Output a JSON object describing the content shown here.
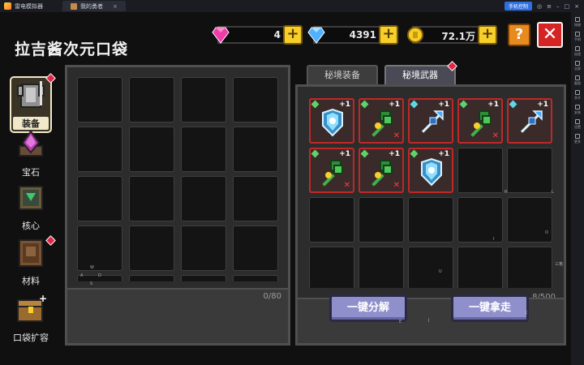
{
  "emulator": {
    "app_name": "雷电模拟器",
    "tab_title": "我的勇者",
    "control_label": "手机控制",
    "side_tools": [
      "按键",
      "手柄",
      "加速",
      "全屏",
      "截图",
      "多开",
      "安装",
      "设置",
      "更多"
    ]
  },
  "header": {
    "title": "拉吉酱次元口袋",
    "currencies": [
      {
        "name": "pink-gem",
        "value": "4",
        "color": "#f03ca8"
      },
      {
        "name": "diamond",
        "value": "4391",
        "color": "#4fb2ff"
      },
      {
        "name": "gold-coin",
        "value": "72.1万",
        "color": "#f6cf2a"
      }
    ],
    "help_label": "?",
    "close_label": "✕"
  },
  "nav": [
    {
      "label": "装备",
      "icon": "armor-icon",
      "active": true,
      "badge": true
    },
    {
      "label": "宝石",
      "icon": "gem-icon",
      "active": false,
      "badge": false
    },
    {
      "label": "核心",
      "icon": "core-icon",
      "active": false,
      "badge": false
    },
    {
      "label": "材料",
      "icon": "materials-icon",
      "active": false,
      "badge": true
    },
    {
      "label": "口袋扩容",
      "icon": "chest-icon",
      "active": false,
      "badge": false
    }
  ],
  "bag": {
    "count": "0/80",
    "tiny_labels": [
      "W",
      "A",
      "D",
      "S"
    ]
  },
  "tabs": [
    {
      "label": "秘境装备",
      "active": false
    },
    {
      "label": "秘境武器",
      "active": true
    }
  ],
  "weapons": {
    "count": "8/500",
    "items": [
      {
        "type": "shield",
        "level": "+1",
        "gem": "#5fd36b",
        "locked": false
      },
      {
        "type": "staff",
        "level": "+1",
        "gem": "#5fd36b",
        "locked": true
      },
      {
        "type": "spear",
        "level": "+1",
        "gem": "#5fd6e6",
        "locked": false
      },
      {
        "type": "staff",
        "level": "+1",
        "gem": "#5fd36b",
        "locked": true
      },
      {
        "type": "spear",
        "level": "+1",
        "gem": "#5fd6e6",
        "locked": false
      },
      {
        "type": "staff",
        "level": "+1",
        "gem": "#5fd36b",
        "locked": true
      },
      {
        "type": "staff",
        "level": "+1",
        "gem": "#5fd36b",
        "locked": true
      },
      {
        "type": "shield",
        "level": "+1",
        "gem": "#5fd36b",
        "locked": false
      }
    ],
    "tiny_labels": [
      "R",
      "L",
      "I",
      "O",
      "U",
      "三格"
    ]
  },
  "actions": {
    "decompose": "一键分解",
    "take_all": "一键拿走",
    "hint_e": "E",
    "hint_j": "J",
    "hint_k": "K"
  }
}
